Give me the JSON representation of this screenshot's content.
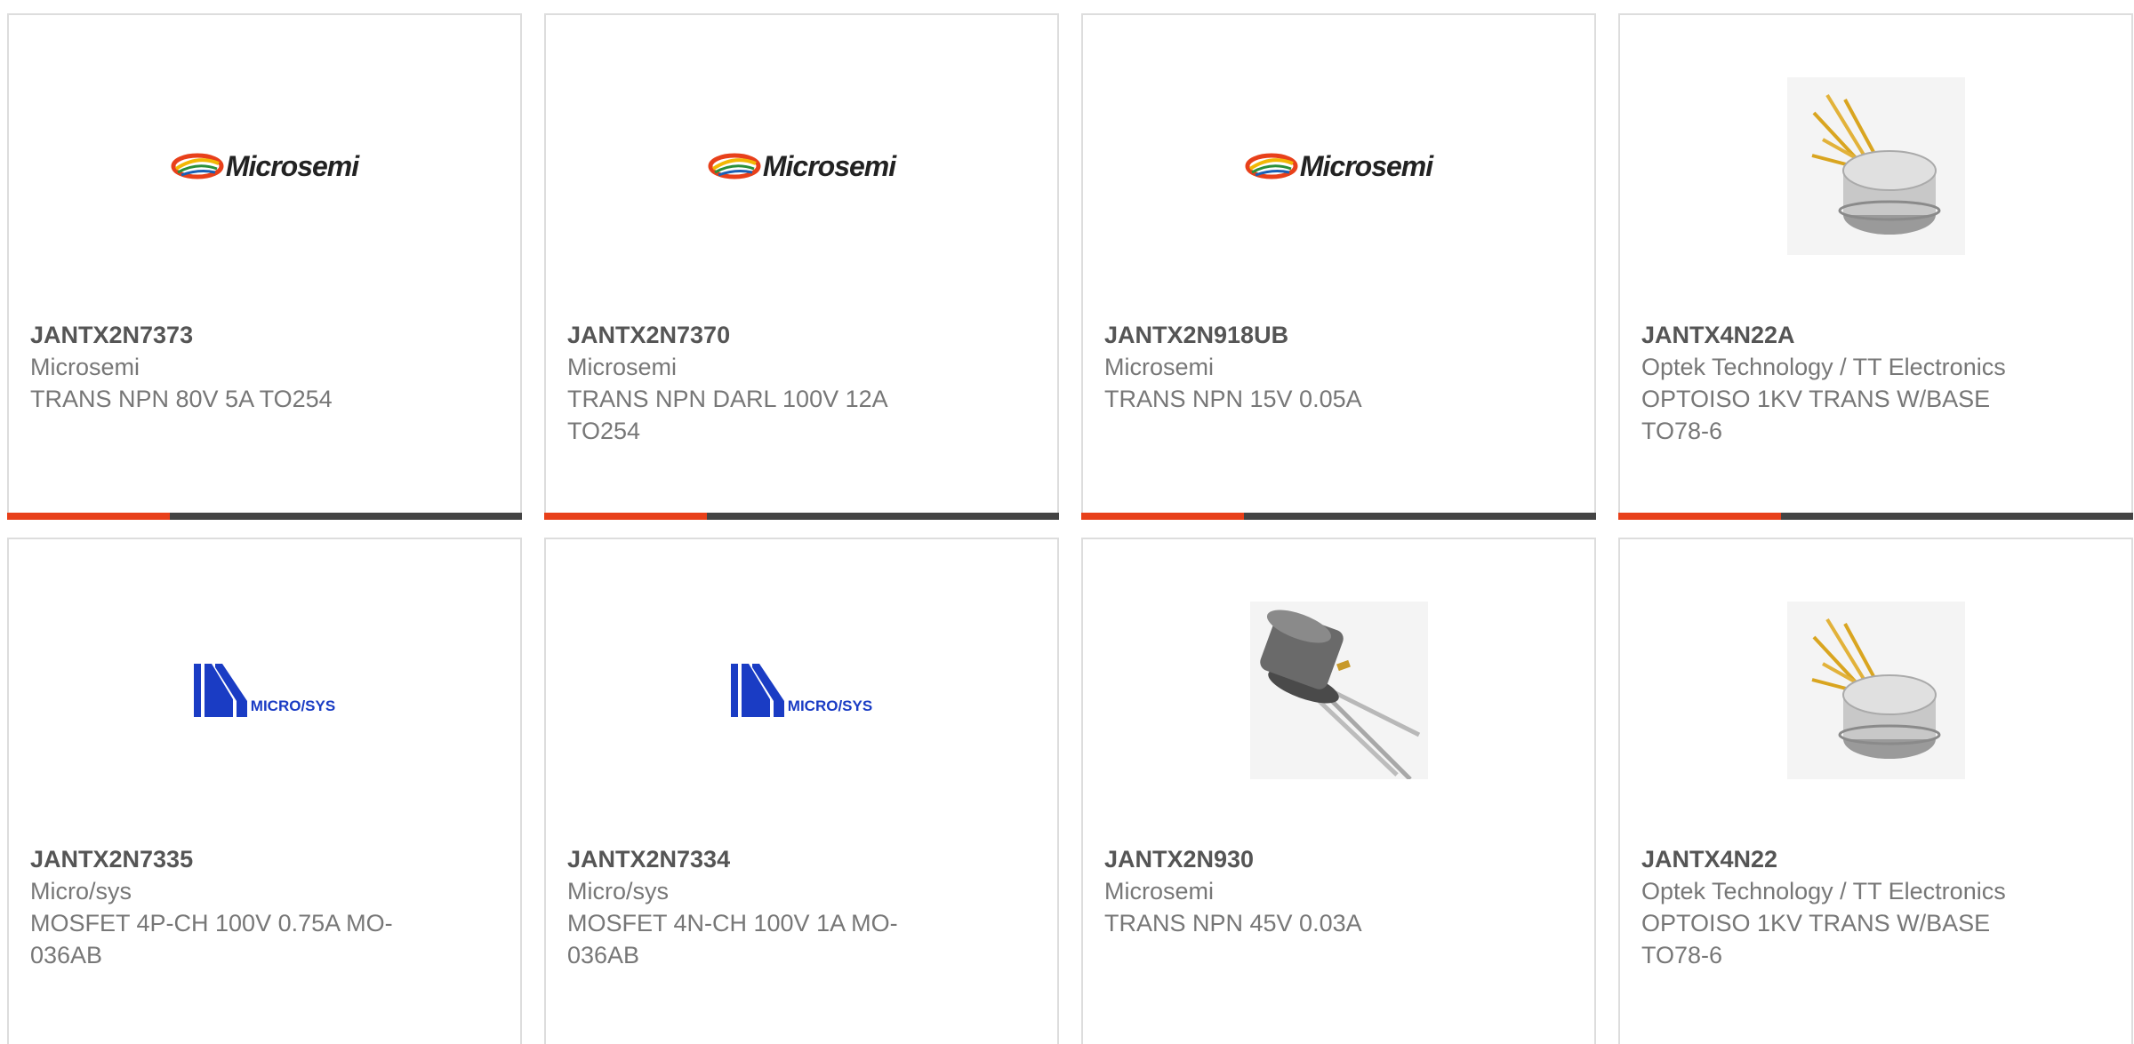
{
  "colors": {
    "accent": "#e8401a",
    "bar_dark": "#444444",
    "part_number": "#555555",
    "body_text": "#777777",
    "border": "#dddddd",
    "microsys_blue": "#1a3cc4"
  },
  "logos": {
    "microsemi_text": "Microsemi",
    "microsys_text": "MICRO/SYS"
  },
  "products": [
    {
      "part_number": "JANTX2N7373",
      "manufacturer": "Microsemi",
      "description": "TRANS NPN 80V 5A TO254",
      "image": "microsemi-logo"
    },
    {
      "part_number": "JANTX2N7370",
      "manufacturer": "Microsemi",
      "description": "TRANS NPN DARL 100V 12A TO254",
      "image": "microsemi-logo"
    },
    {
      "part_number": "JANTX2N918UB",
      "manufacturer": "Microsemi",
      "description": "TRANS NPN 15V 0.05A",
      "image": "microsemi-logo"
    },
    {
      "part_number": "JANTX4N22A",
      "manufacturer": "Optek Technology / TT Electronics",
      "description": "OPTOISO 1KV TRANS W/BASE TO78-6",
      "image": "to78-gold-lead-package-photo"
    },
    {
      "part_number": "JANTX2N7335",
      "manufacturer": "Micro/sys",
      "description": "MOSFET 4P-CH 100V 0.75A MO-036AB",
      "image": "microsys-logo"
    },
    {
      "part_number": "JANTX2N7334",
      "manufacturer": "Micro/sys",
      "description": "MOSFET 4N-CH 100V 1A MO-036AB",
      "image": "microsys-logo"
    },
    {
      "part_number": "JANTX2N930",
      "manufacturer": "Microsemi",
      "description": "TRANS NPN 45V 0.03A",
      "image": "to18-transistor-photo"
    },
    {
      "part_number": "JANTX4N22",
      "manufacturer": "Optek Technology / TT Electronics",
      "description": "OPTOISO 1KV TRANS W/BASE TO78-6",
      "image": "to78-gold-lead-package-photo"
    }
  ]
}
